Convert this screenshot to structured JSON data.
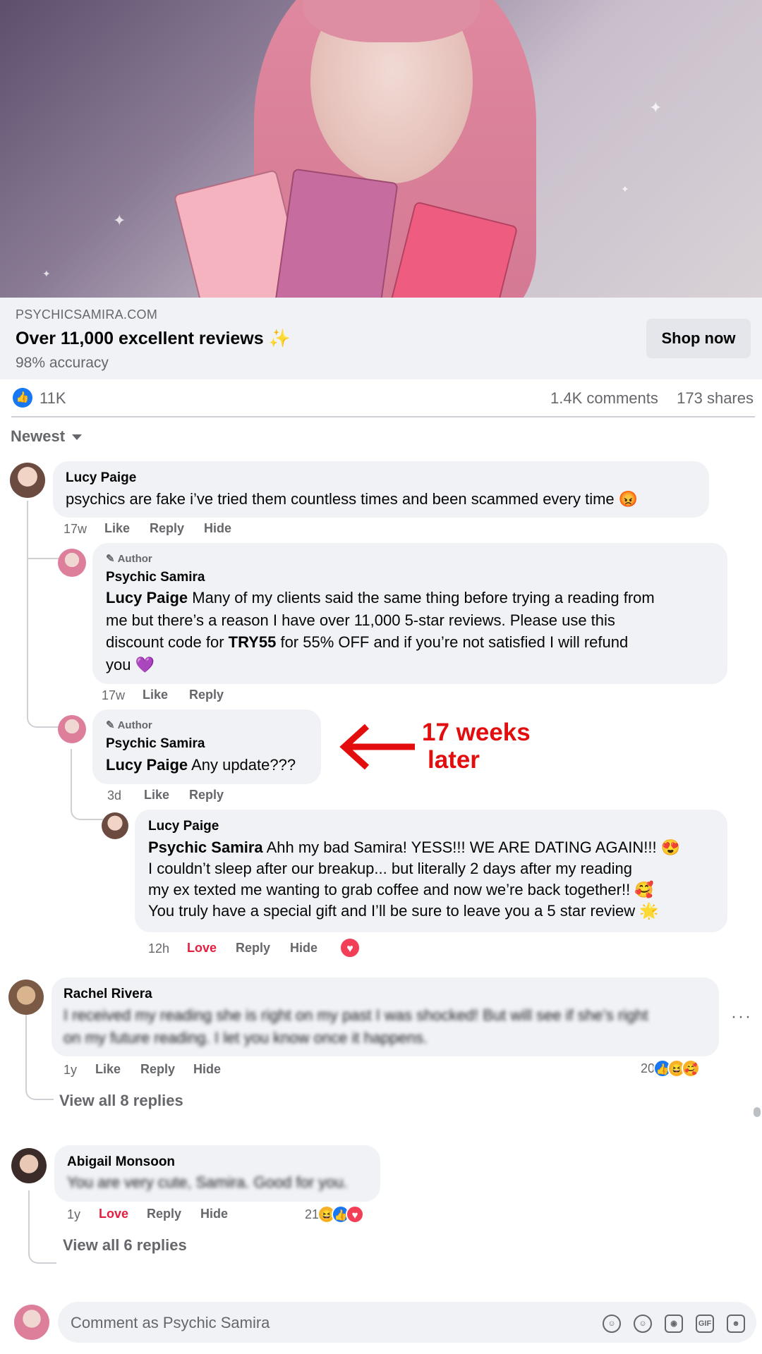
{
  "ad": {
    "domain": "PSYCHICSAMIRA.COM",
    "headline": "Over 11,000 excellent reviews ✨",
    "subline": "98% accuracy",
    "cta": "Shop now"
  },
  "stats": {
    "likes": "11K",
    "comments": "1.4K comments",
    "shares": "173 shares"
  },
  "sort": {
    "label": "Newest"
  },
  "comments": [
    {
      "author": "Lucy Paige",
      "text": "psychics are fake i’ve tried them countless times and been scammed every time 😡",
      "time": "17w",
      "actions": [
        "Like",
        "Reply",
        "Hide"
      ],
      "replies": [
        {
          "badge": "Author",
          "author": "Psychic Samira",
          "mention": "Lucy Paige",
          "lines": [
            "Many of my clients said the same thing before trying a reading from",
            "me but there’s a reason I have over 11,000 5-star reviews. Please use this",
            "discount code for",
            "for 55% OFF and if you’re not satisfied I will refund",
            "you 💜"
          ],
          "code": "TRY55",
          "time": "17w",
          "actions": [
            "Like",
            "Reply"
          ]
        },
        {
          "badge": "Author",
          "author": "Psychic Samira",
          "mention": "Lucy Paige",
          "text": "Any update???",
          "time": "3d",
          "actions": [
            "Like",
            "Reply"
          ],
          "replies": [
            {
              "author": "Lucy Paige",
              "mention": "Psychic Samira",
              "lines": [
                "Ahh my bad Samira! YESS!!! WE ARE DATING AGAIN!!! 😍",
                "I couldn’t sleep after our breakup... but literally 2 days after my reading",
                "my ex texted me wanting to grab coffee and now we’re back together!! 🥰",
                "You truly have a special gift and I’ll be sure to leave you a 5 star review 🌟"
              ],
              "time": "12h",
              "actions": [
                "Love",
                "Reply",
                "Hide"
              ],
              "reaction": "heart"
            }
          ]
        }
      ]
    },
    {
      "author": "Rachel Rivera",
      "lines": [
        "I received my reading she is right on my past I was shocked! But will see if she’s right",
        "on my future reading. I let you know once it happens."
      ],
      "time": "1y",
      "actions": [
        "Like",
        "Reply",
        "Hide"
      ],
      "reaction_count": "20",
      "reactions": [
        "like",
        "haha",
        "care"
      ],
      "view_all": "View all 8 replies",
      "more": "···"
    },
    {
      "author": "Abigail Monsoon",
      "text": "You are very cute, Samira. Good for you.",
      "time": "1y",
      "actions": [
        "Love",
        "Reply",
        "Hide"
      ],
      "reaction_count": "21",
      "reactions": [
        "haha",
        "like",
        "love"
      ],
      "view_all": "View all 6 replies"
    }
  ],
  "annotation": {
    "line1": "17 weeks",
    "line2": "later",
    "color": "#e30d0d"
  },
  "composer": {
    "placeholder": "Comment as Psychic Samira",
    "icons": [
      "avatar-sticker-icon",
      "emoji-icon",
      "camera-icon",
      "gif-icon",
      "sticker-icon"
    ]
  },
  "colors": {
    "accent": "#1877f2",
    "love": "#e41e3f",
    "bubble": "#f0f2f5",
    "muted": "#65676b"
  }
}
